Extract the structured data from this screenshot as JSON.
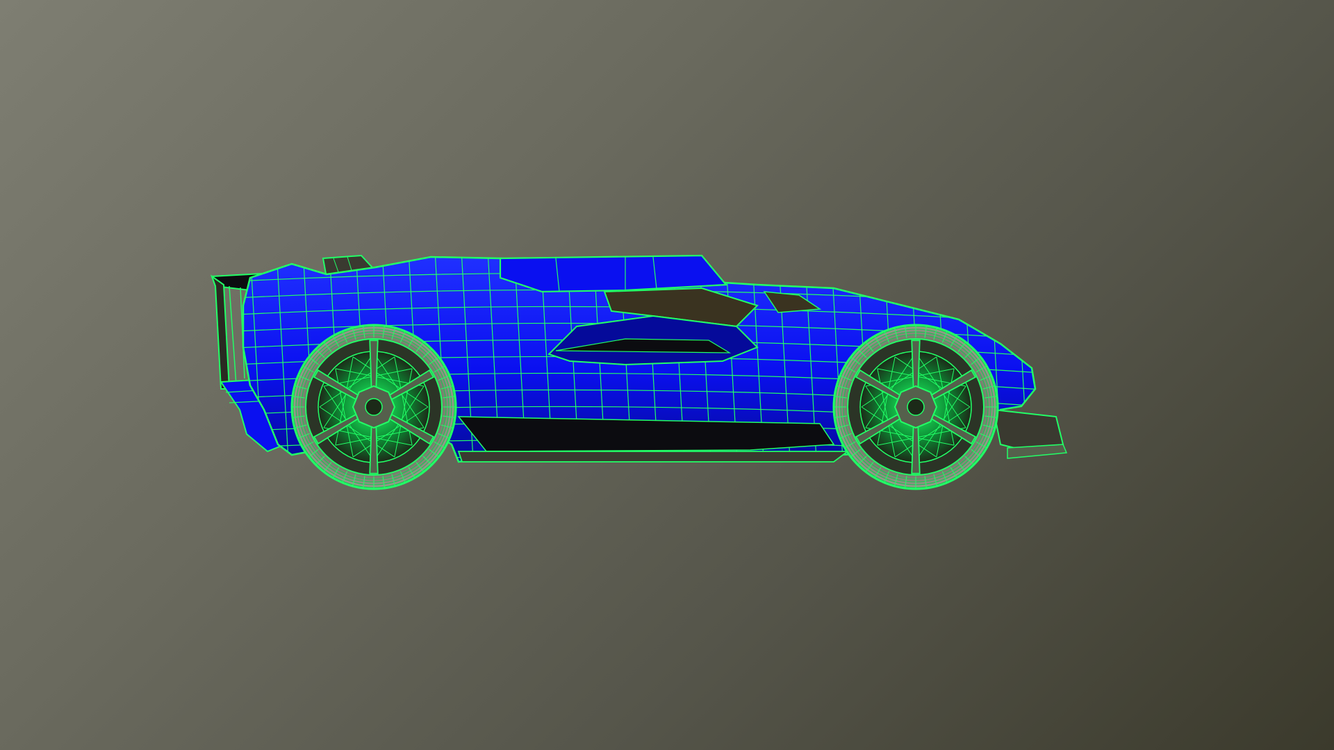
{
  "scene": {
    "subject": "car-wireframe-model",
    "view": "side",
    "render_mode": "shaded-wireframe"
  },
  "colors": {
    "background_light": "#7e7e72",
    "background_dark": "#3b3a2c",
    "body": "#0a10f0",
    "body_highlight": "#2030ff",
    "body_shadow": "#050a9a",
    "wire": "#22ff66",
    "wire_dim": "#18c450",
    "dark_panel": "#0c0c10",
    "cavity": "#3a3320",
    "tire": "#9aa090",
    "rim": "#55604c"
  },
  "icons": []
}
